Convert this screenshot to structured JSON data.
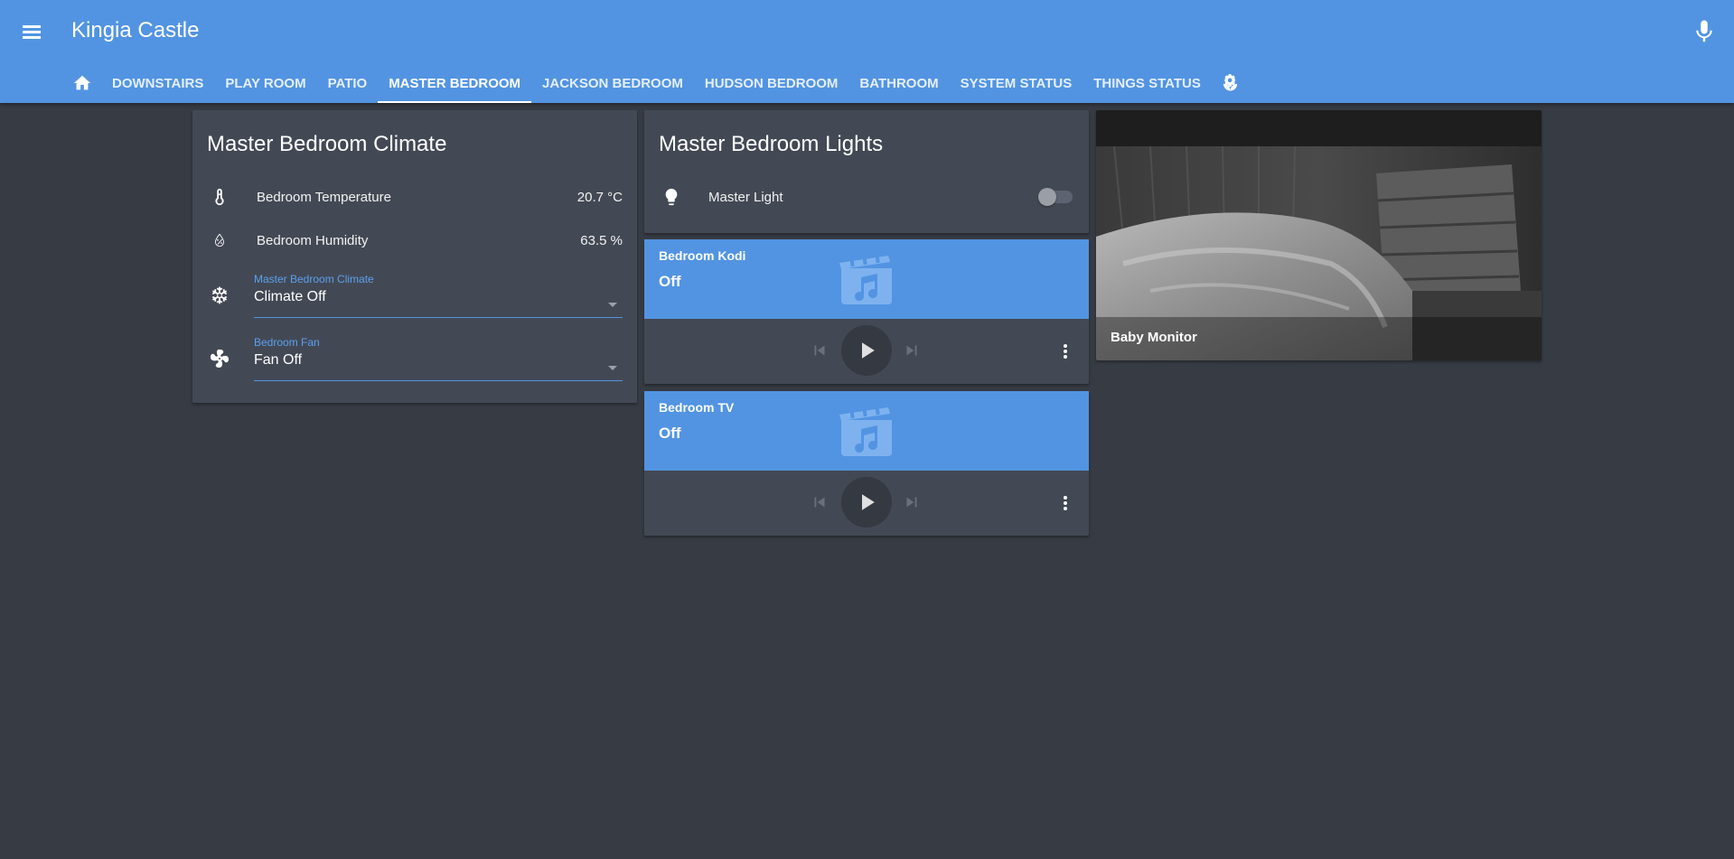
{
  "app": {
    "title": "Kingia Castle"
  },
  "tabs": [
    {
      "label": "DOWNSTAIRS"
    },
    {
      "label": "PLAY ROOM"
    },
    {
      "label": "PATIO"
    },
    {
      "label": "MASTER BEDROOM",
      "active": true
    },
    {
      "label": "JACKSON BEDROOM"
    },
    {
      "label": "HUDSON BEDROOM"
    },
    {
      "label": "BATHROOM"
    },
    {
      "label": "SYSTEM STATUS"
    },
    {
      "label": "THINGS STATUS"
    }
  ],
  "icons": {
    "menu": "menu-icon",
    "mic": "microphone-icon",
    "home": "home-icon",
    "last_tab": "flower-icon"
  },
  "climate": {
    "title": "Master Bedroom Climate",
    "temperature": {
      "label": "Bedroom Temperature",
      "value": "20.7 °C",
      "icon": "thermometer-icon"
    },
    "humidity": {
      "label": "Bedroom Humidity",
      "value": "63.5 %",
      "icon": "water-percent-icon"
    },
    "climate_select": {
      "label": "Master Bedroom Climate",
      "value": "Climate Off",
      "icon": "snowflake-icon"
    },
    "fan_select": {
      "label": "Bedroom Fan",
      "value": "Fan Off",
      "icon": "fan-icon"
    }
  },
  "lights": {
    "title": "Master Bedroom Lights",
    "master_light": {
      "label": "Master Light",
      "state": "off",
      "icon": "lightbulb-icon"
    }
  },
  "media": [
    {
      "name": "Bedroom Kodi",
      "state": "Off"
    },
    {
      "name": "Bedroom TV",
      "state": "Off"
    }
  ],
  "camera": {
    "caption": "Baby Monitor"
  },
  "colors": {
    "accent": "#5294e2",
    "background": "#373b44",
    "card": "#434954"
  }
}
